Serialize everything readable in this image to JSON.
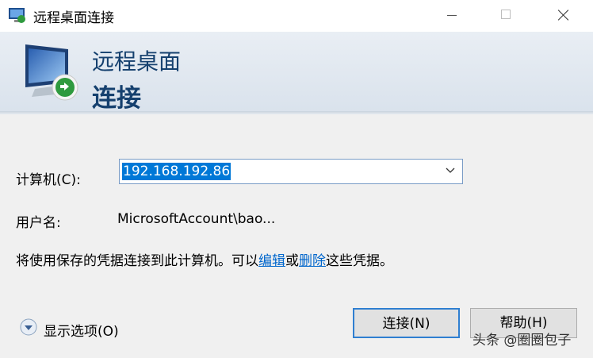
{
  "window": {
    "title": "远程桌面连接",
    "buttons": {
      "minimize": "minimize",
      "maximize": "maximize",
      "close": "close"
    }
  },
  "banner": {
    "line1": "远程桌面",
    "line2": "连接"
  },
  "form": {
    "computer_label": "计算机(C):",
    "computer_value": "192.168.192.86",
    "username_label": "用户名:",
    "username_value": "MicrosoftAccount\\bao...",
    "note_prefix": "将使用保存的凭据连接到此计算机。可以",
    "note_edit_link": "编辑",
    "note_or": "或",
    "note_delete_link": "删除",
    "note_suffix": "这些凭据。"
  },
  "footer": {
    "show_options": "显示选项(O)",
    "connect_button": "连接(N)",
    "help_button": "帮助(H)"
  },
  "watermark": "头条 @圈圈包子",
  "colors": {
    "accent": "#0078d7",
    "banner_text": "#15406e",
    "link": "#0066cc"
  }
}
